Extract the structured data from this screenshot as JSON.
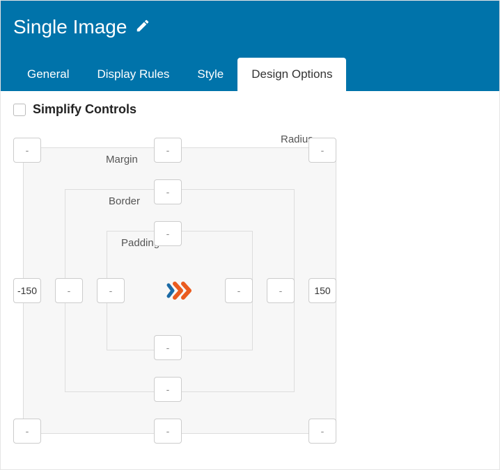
{
  "header": {
    "title": "Single Image"
  },
  "tabs": {
    "general": "General",
    "display_rules": "Display Rules",
    "style": "Style",
    "design_options": "Design Options"
  },
  "simplify_label": "Simplify Controls",
  "labels": {
    "margin": "Margin",
    "border": "Border",
    "padding": "Padding",
    "radius": "Radius"
  },
  "box_model": {
    "margin": {
      "top": "",
      "right": "150",
      "bottom": "",
      "left": "-150"
    },
    "border": {
      "top": "",
      "right": "",
      "bottom": "",
      "left": ""
    },
    "padding": {
      "top": "",
      "right": "",
      "bottom": "",
      "left": ""
    },
    "radius": {
      "tl": "",
      "tr": "",
      "br": "",
      "bl": ""
    }
  },
  "placeholder": "-"
}
